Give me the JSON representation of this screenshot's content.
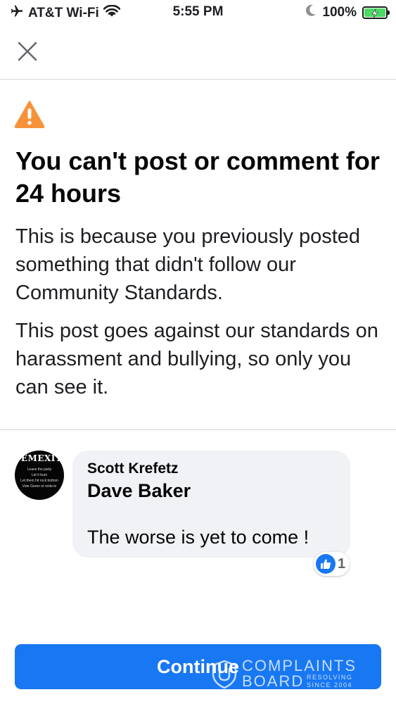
{
  "status_bar": {
    "carrier": "AT&T Wi-Fi",
    "time": "5:55 PM",
    "battery_percent": "100%",
    "airplane_icon": "airplane-icon",
    "wifi_icon": "wifi-icon",
    "moon_icon": "moon-icon",
    "battery_icon": "battery-charging-icon"
  },
  "header": {
    "close_icon": "close-icon"
  },
  "notice": {
    "warning_icon": "warning-icon",
    "warning_color": "#f7923a",
    "title": "You can't post or comment for 24 hours",
    "paragraph_1": "This is because you previously posted something that didn't follow our Community Standards.",
    "paragraph_2": "This post goes against our standards on harassment and bullying, so only you can see it."
  },
  "comment": {
    "avatar": {
      "title": "DEMEXIT",
      "lines": [
        "Leave the party",
        "Let it burn",
        "Let them hit rock bottom",
        "Vote Green or write-in"
      ]
    },
    "author": "Scott Krefetz",
    "mention": "Dave Baker",
    "text": "The worse is yet to come !",
    "reaction_icon": "like-icon",
    "reaction_count": "1"
  },
  "footer": {
    "continue_label": "Continue",
    "button_color": "#1877f2"
  },
  "watermark": {
    "line1": "COMPLAINTS",
    "line2": "BOARD",
    "tagline1": "RESOLVING",
    "tagline2": "SINCE 2004"
  }
}
